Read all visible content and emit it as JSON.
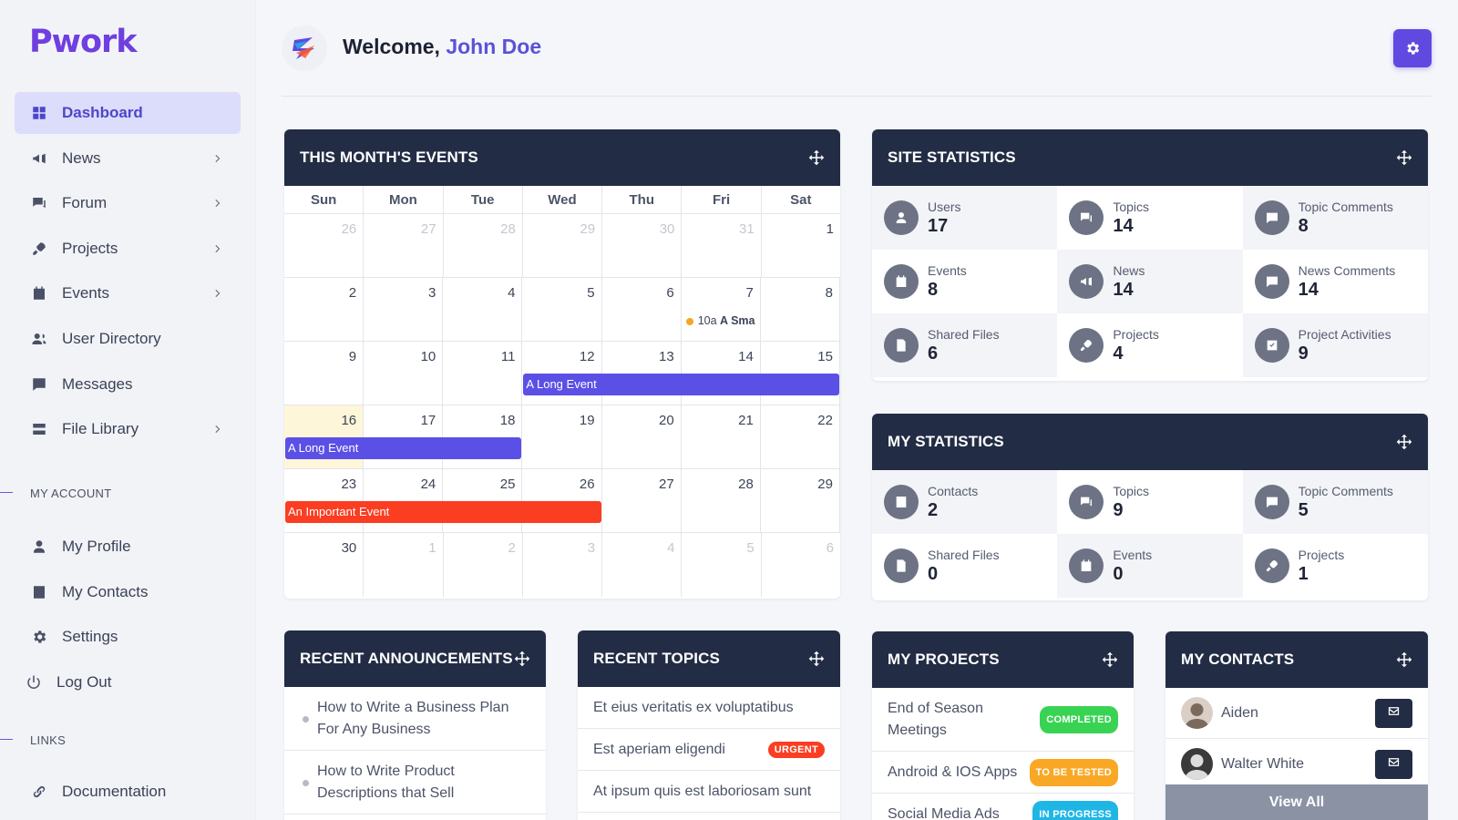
{
  "brand": {
    "name": "Pwork",
    "color": "#6f3fe0"
  },
  "header": {
    "welcome": "Welcome,",
    "user_name": "John Doe"
  },
  "sidebar": {
    "items": [
      {
        "label": "Dashboard",
        "icon": "grid-icon",
        "active": true
      },
      {
        "label": "News",
        "icon": "megaphone-icon",
        "chevron": true
      },
      {
        "label": "Forum",
        "icon": "chat-icon",
        "chevron": true
      },
      {
        "label": "Projects",
        "icon": "rocket-icon",
        "chevron": true
      },
      {
        "label": "Events",
        "icon": "calendar-icon",
        "chevron": true
      },
      {
        "label": "User Directory",
        "icon": "users-icon"
      },
      {
        "label": "Messages",
        "icon": "message-icon"
      },
      {
        "label": "File Library",
        "icon": "server-icon",
        "chevron": true
      }
    ],
    "my_account_label": "MY ACCOUNT",
    "account_items": [
      {
        "label": "My Profile",
        "icon": "user-icon"
      },
      {
        "label": "My Contacts",
        "icon": "contact-card-icon"
      },
      {
        "label": "Settings",
        "icon": "gear-icon"
      },
      {
        "label": "Log Out",
        "icon": "power-icon"
      }
    ],
    "links_label": "LINKS",
    "link_items": [
      {
        "label": "Documentation",
        "icon": "link-icon"
      }
    ]
  },
  "events_card": {
    "title": "THIS MONTH'S EVENTS",
    "days_of_week": [
      "Sun",
      "Mon",
      "Tue",
      "Wed",
      "Thu",
      "Fri",
      "Sat"
    ],
    "weeks": [
      [
        {
          "d": "26",
          "o": true
        },
        {
          "d": "27",
          "o": true
        },
        {
          "d": "28",
          "o": true
        },
        {
          "d": "29",
          "o": true
        },
        {
          "d": "30",
          "o": true
        },
        {
          "d": "31",
          "o": true
        },
        {
          "d": "1"
        }
      ],
      [
        {
          "d": "2"
        },
        {
          "d": "3"
        },
        {
          "d": "4"
        },
        {
          "d": "5"
        },
        {
          "d": "6"
        },
        {
          "d": "7"
        },
        {
          "d": "8"
        }
      ],
      [
        {
          "d": "9"
        },
        {
          "d": "10"
        },
        {
          "d": "11"
        },
        {
          "d": "12"
        },
        {
          "d": "13"
        },
        {
          "d": "14"
        },
        {
          "d": "15"
        }
      ],
      [
        {
          "d": "16",
          "today": true
        },
        {
          "d": "17"
        },
        {
          "d": "18"
        },
        {
          "d": "19"
        },
        {
          "d": "20"
        },
        {
          "d": "21"
        },
        {
          "d": "22"
        }
      ],
      [
        {
          "d": "23"
        },
        {
          "d": "24"
        },
        {
          "d": "25"
        },
        {
          "d": "26"
        },
        {
          "d": "27"
        },
        {
          "d": "28"
        },
        {
          "d": "29"
        }
      ],
      [
        {
          "d": "30"
        },
        {
          "d": "1",
          "o": true
        },
        {
          "d": "2",
          "o": true
        },
        {
          "d": "3",
          "o": true
        },
        {
          "d": "4",
          "o": true
        },
        {
          "d": "5",
          "o": true
        },
        {
          "d": "6",
          "o": true
        }
      ]
    ],
    "events": [
      {
        "type": "dot",
        "time": "10a",
        "title": "A Sma",
        "week": 1,
        "start": 5,
        "end": 5
      },
      {
        "type": "bar",
        "title": "A Long Event",
        "week": 2,
        "start": 3,
        "end": 6,
        "color": "#5b50e6"
      },
      {
        "type": "bar",
        "title": "A Long Event",
        "week": 3,
        "start": 0,
        "end": 2,
        "color": "#5b50e6"
      },
      {
        "type": "bar",
        "title": "An Important Event",
        "week": 4,
        "start": 0,
        "end": 3,
        "color": "#fb3d22"
      }
    ]
  },
  "site_stats": {
    "title": "SITE STATISTICS",
    "items": [
      {
        "label": "Users",
        "value": "17",
        "icon": "user-icon"
      },
      {
        "label": "Topics",
        "value": "14",
        "icon": "chat-icon"
      },
      {
        "label": "Topic Comments",
        "value": "8",
        "icon": "comment-icon"
      },
      {
        "label": "Events",
        "value": "8",
        "icon": "calendar-icon"
      },
      {
        "label": "News",
        "value": "14",
        "icon": "megaphone-icon"
      },
      {
        "label": "News Comments",
        "value": "14",
        "icon": "comment-icon"
      },
      {
        "label": "Shared Files",
        "value": "6",
        "icon": "file-icon"
      },
      {
        "label": "Projects",
        "value": "4",
        "icon": "rocket-icon"
      },
      {
        "label": "Project Activities",
        "value": "9",
        "icon": "check-icon"
      }
    ]
  },
  "my_stats": {
    "title": "MY STATISTICS",
    "items": [
      {
        "label": "Contacts",
        "value": "2",
        "icon": "contact-card-icon"
      },
      {
        "label": "Topics",
        "value": "9",
        "icon": "chat-icon"
      },
      {
        "label": "Topic Comments",
        "value": "5",
        "icon": "comment-icon"
      },
      {
        "label": "Shared Files",
        "value": "0",
        "icon": "file-icon"
      },
      {
        "label": "Events",
        "value": "0",
        "icon": "calendar-icon"
      },
      {
        "label": "Projects",
        "value": "1",
        "icon": "rocket-icon"
      }
    ]
  },
  "announcements": {
    "title": "RECENT ANNOUNCEMENTS",
    "items": [
      "How to Write a Business Plan For Any Business",
      "How to Write Product Descriptions that Sell"
    ]
  },
  "topics": {
    "title": "RECENT TOPICS",
    "items": [
      {
        "label": "Et eius veritatis ex voluptatibus"
      },
      {
        "label": "Est aperiam eligendi",
        "badge": "URGENT",
        "badge_color": "#fb3d22"
      },
      {
        "label": "At ipsum quis est laboriosam sunt"
      }
    ]
  },
  "projects": {
    "title": "MY PROJECTS",
    "items": [
      {
        "label": "End of Season Meetings",
        "badge": "COMPLETED",
        "badge_color": "#39d353"
      },
      {
        "label": "Android & IOS Apps",
        "badge": "TO BE TESTED",
        "badge_color": "#f9a825"
      },
      {
        "label": "Social Media Ads",
        "badge": "IN PROGRESS",
        "badge_color": "#1fb6e6"
      }
    ]
  },
  "contacts": {
    "title": "MY CONTACTS",
    "items": [
      {
        "name": "Aiden"
      },
      {
        "name": "Walter White"
      }
    ],
    "view_all": "View All"
  }
}
